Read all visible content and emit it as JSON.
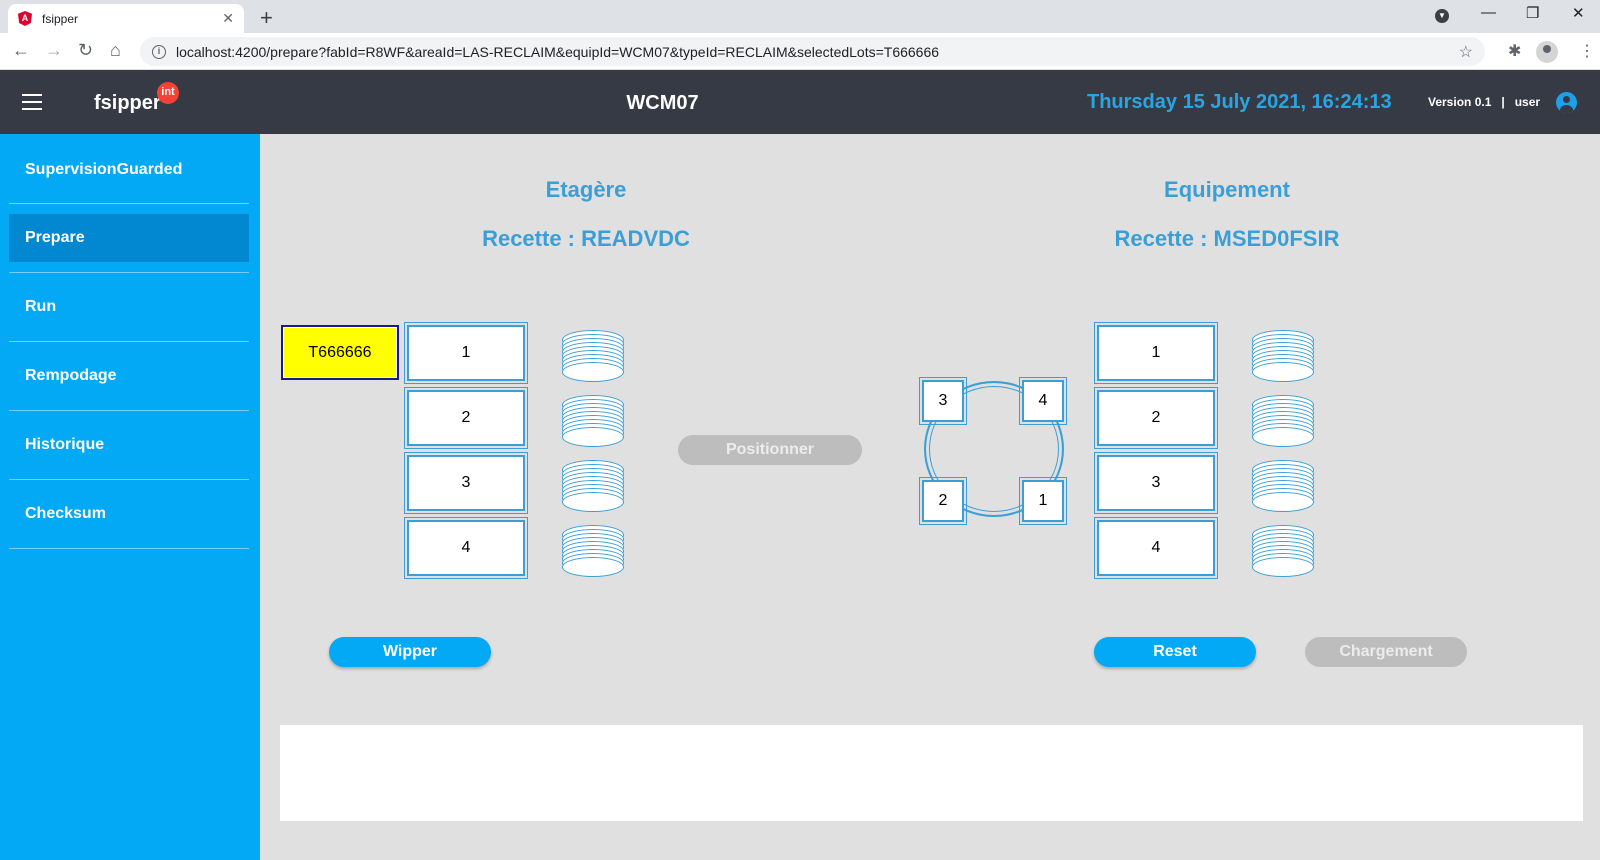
{
  "browser": {
    "tab_title": "fsipper",
    "url": "localhost:4200/prepare?fabId=R8WF&areaId=LAS-RECLAIM&equipId=WCM07&typeId=RECLAIM&selectedLots=T666666",
    "icons": [
      "angular-icon",
      "close-icon",
      "plus-icon",
      "back-icon",
      "forward-icon",
      "reload-icon",
      "home-icon",
      "info-icon",
      "star-icon",
      "puzzle-icon",
      "profile-icon",
      "more-icon"
    ]
  },
  "toolbar": {
    "brand": "fsipper",
    "badge": "int",
    "equipment": "WCM07",
    "datetime": "Thursday 15 July 2021, 16:24:13",
    "version_user": "Version 0.1   |   user",
    "datetime_color": "#2aa5e3",
    "bg_color": "#363a45"
  },
  "sidebar": {
    "bg_color": "#03a9f4",
    "items": [
      {
        "label": "SupervisionGuarded",
        "active": false
      },
      {
        "label": "Prepare",
        "active": true
      },
      {
        "label": "Run",
        "active": false
      },
      {
        "label": "Rempodage",
        "active": false
      },
      {
        "label": "Historique",
        "active": false
      },
      {
        "label": "Checksum",
        "active": false
      }
    ]
  },
  "shelf": {
    "title": "Etagère",
    "recipe": "Recette : READVDC",
    "lot": "T666666",
    "slots": [
      "1",
      "2",
      "3",
      "4"
    ]
  },
  "equipment": {
    "title": "Equipement",
    "recipe": "Recette : MSED0FSIR",
    "ring_slots": [
      "3",
      "4",
      "2",
      "1"
    ],
    "slots": [
      "1",
      "2",
      "3",
      "4"
    ]
  },
  "buttons": {
    "positionner": "Positionner",
    "wipper": "Wipper",
    "reset": "Reset",
    "chargement": "Chargement"
  }
}
